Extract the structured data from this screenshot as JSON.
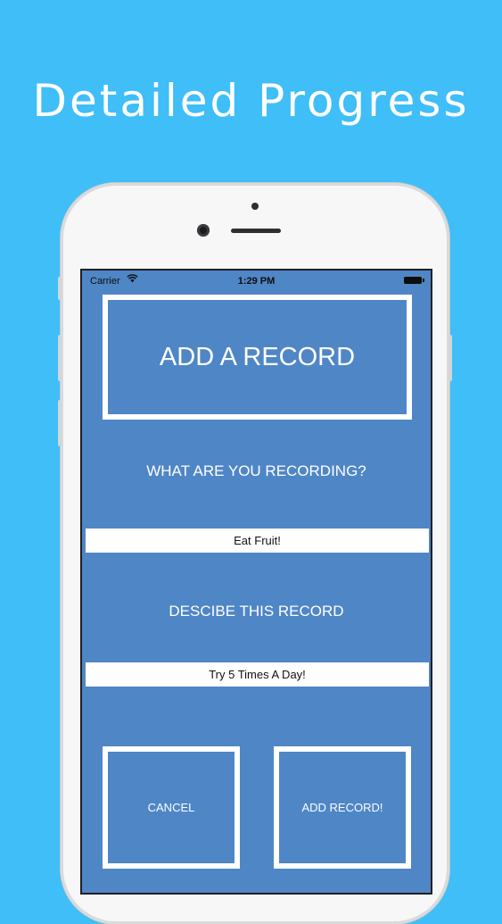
{
  "headline": "Detailed Progress",
  "status_bar": {
    "carrier": "Carrier",
    "time": "1:29 PM"
  },
  "form": {
    "title": "ADD A RECORD",
    "recording_label": "WHAT ARE YOU RECORDING?",
    "recording_value": "Eat Fruit!",
    "describe_label": "DESCIBE THIS RECORD",
    "describe_value": "Try 5 Times A Day!"
  },
  "buttons": {
    "cancel": "CANCEL",
    "add": "ADD RECORD!"
  },
  "colors": {
    "background": "#3fbef8",
    "screen": "#4f86c6",
    "text_light": "#ffffff"
  },
  "icons": [
    "wifi-icon",
    "battery-icon"
  ]
}
